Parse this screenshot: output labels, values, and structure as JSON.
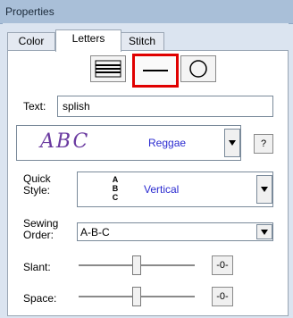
{
  "window": {
    "title": "Properties"
  },
  "tabs": [
    {
      "label": "Color",
      "active": false
    },
    {
      "label": "Letters",
      "active": true
    },
    {
      "label": "Stitch",
      "active": false
    }
  ],
  "shape_buttons": [
    {
      "name": "stacked-lines-icon",
      "selected": false
    },
    {
      "name": "single-line-icon",
      "selected": true
    },
    {
      "name": "circle-icon",
      "selected": false
    }
  ],
  "text_field": {
    "label": "Text:",
    "value": "splish"
  },
  "font": {
    "preview": "ABC",
    "name": "Reggae",
    "help_label": "?"
  },
  "quick_style": {
    "label_line1": "Quick",
    "label_line2": "Style:",
    "icon_letters": [
      "A",
      "B",
      "C"
    ],
    "value": "Vertical"
  },
  "sewing_order": {
    "label_line1": "Sewing",
    "label_line2": "Order:",
    "value": "A-B-C"
  },
  "slant": {
    "label": "Slant:",
    "reset_label": "-0-",
    "level": 0.5
  },
  "space": {
    "label": "Space:",
    "reset_label": "-0-",
    "level": 0.5
  },
  "colors": {
    "accent_text": "#2a2ad0",
    "preview_text": "#6a3aa0",
    "selection_border": "#e00000"
  }
}
